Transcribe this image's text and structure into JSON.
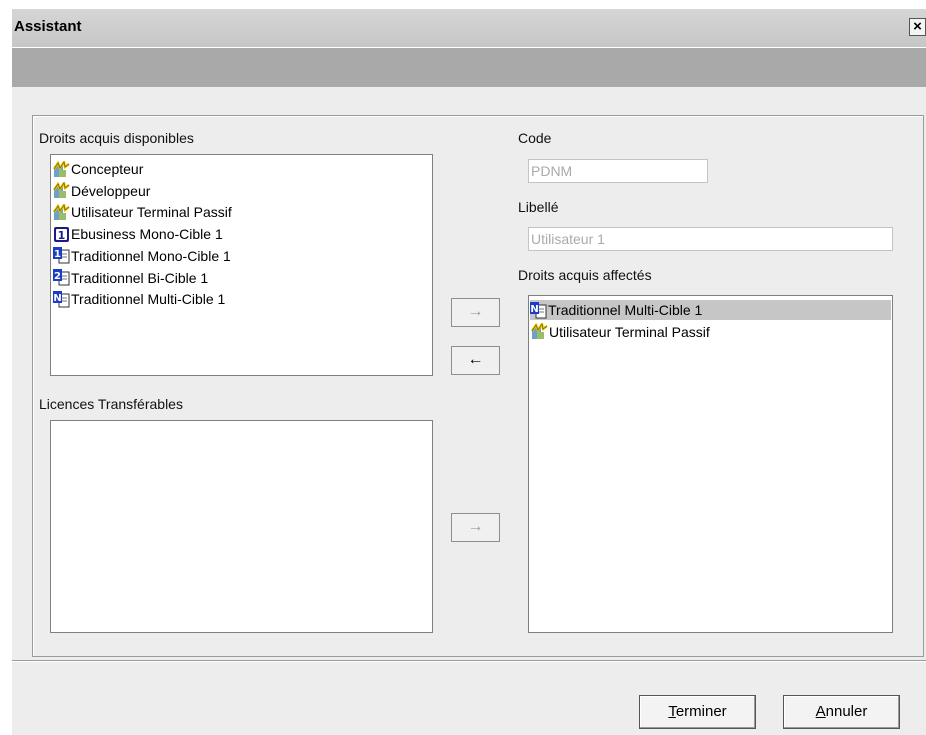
{
  "window": {
    "title": "Assistant",
    "close_glyph": "×"
  },
  "left": {
    "available_label": "Droits acquis disponibles",
    "available_items": [
      {
        "label": "Concepteur",
        "icon": "lightning-role-icon"
      },
      {
        "label": "Développeur",
        "icon": "lightning-role-icon"
      },
      {
        "label": "Utilisateur Terminal Passif",
        "icon": "lightning-role-icon"
      },
      {
        "label": "Ebusiness Mono-Cible 1",
        "icon": "license-1-icon"
      },
      {
        "label": "Traditionnel Mono-Cible 1",
        "icon": "license-1-doc-icon"
      },
      {
        "label": "Traditionnel Bi-Cible 1",
        "icon": "license-2-doc-icon"
      },
      {
        "label": "Traditionnel Multi-Cible 1",
        "icon": "license-n-doc-icon"
      }
    ],
    "transferable_label": "Licences Transférables"
  },
  "arrows": {
    "add": "→",
    "remove": "←",
    "add_transfer": "→"
  },
  "right": {
    "code_label": "Code",
    "code_value": "PDNM",
    "libelle_label": "Libellé",
    "libelle_value": "Utilisateur 1",
    "assigned_label": "Droits acquis affectés",
    "assigned_items": [
      {
        "label": "Traditionnel Multi-Cible 1",
        "icon": "license-n-doc-icon",
        "selected": true
      },
      {
        "label": "Utilisateur Terminal Passif",
        "icon": "lightning-role-icon",
        "selected": false
      }
    ]
  },
  "footer": {
    "finish_mnemonic": "T",
    "finish_rest": "erminer",
    "cancel_mnemonic": "A",
    "cancel_rest": "nnuler"
  }
}
